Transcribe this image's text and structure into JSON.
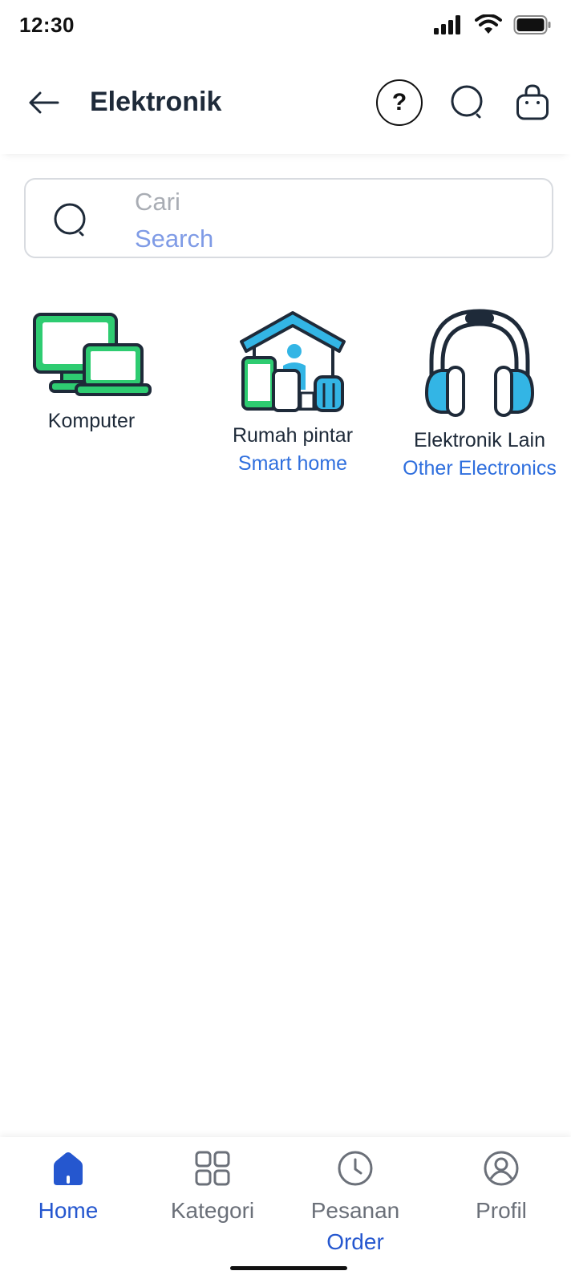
{
  "status_bar": {
    "time": "12:30"
  },
  "app_bar": {
    "title": "Elektronik"
  },
  "search": {
    "placeholder": "Cari",
    "placeholder_en": "Search"
  },
  "categories": [
    {
      "label": "Komputer",
      "label_en": "",
      "icon": "computer-devices-icon"
    },
    {
      "label": "Rumah pintar",
      "label_en": "Smart home",
      "icon": "smart-home-icon"
    },
    {
      "label": "Elektronik Lain",
      "label_en": "Other Electronics",
      "icon": "headphones-icon"
    }
  ],
  "bottom_nav": {
    "items": [
      {
        "label": "Home",
        "label_en": "",
        "icon": "home-icon",
        "active": true
      },
      {
        "label": "Kategori",
        "label_en": "",
        "icon": "grid-icon",
        "active": false
      },
      {
        "label": "Pesanan",
        "label_en": "Order",
        "icon": "clock-icon",
        "active": false
      },
      {
        "label": "Profil",
        "label_en": "",
        "icon": "user-icon",
        "active": false
      }
    ]
  },
  "colors": {
    "accent": "#2557cf",
    "link": "#2f6fde",
    "green": "#2ecc71",
    "blue": "#33b5e5",
    "text": "#1e2a39"
  }
}
